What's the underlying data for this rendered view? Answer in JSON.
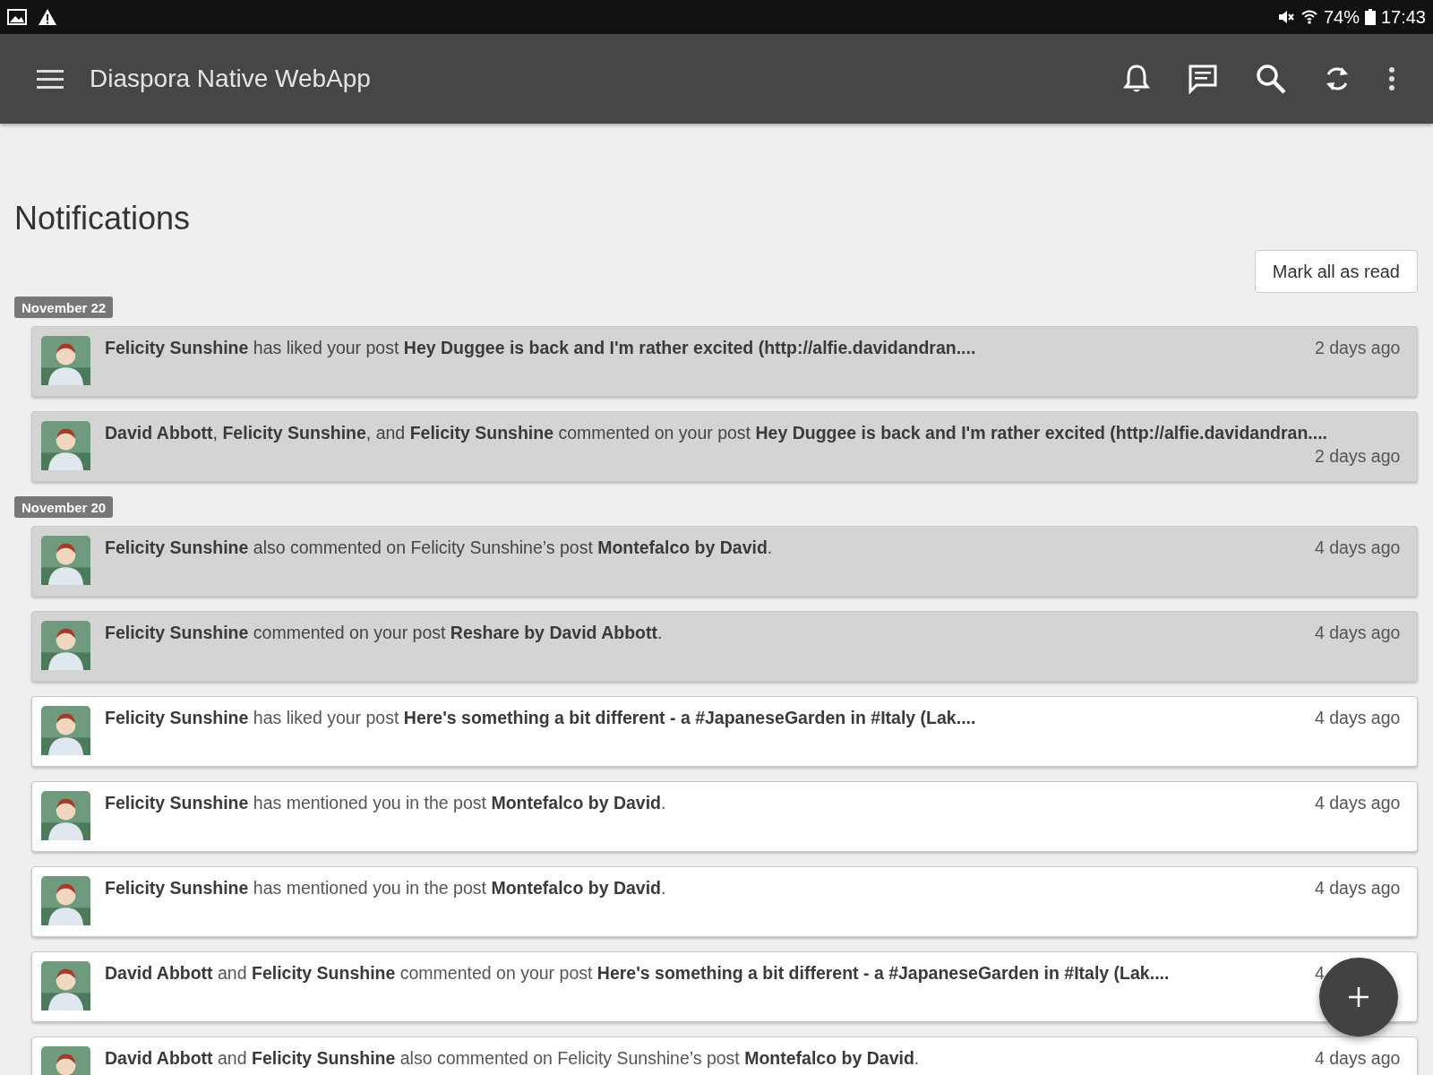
{
  "status_bar": {
    "battery": "74%",
    "time": "17:43"
  },
  "app_bar": {
    "title": "Diaspora Native WebApp"
  },
  "page": {
    "title": "Notifications",
    "mark_all_button": "Mark all as read"
  },
  "groups": [
    {
      "date": "November 22",
      "notifications": [
        {
          "text": "**Felicity Sunshine** has liked your post **Hey Duggee is back and I'm rather excited (http://alfie.davidandran....**",
          "time": "2 days ago",
          "unread": true
        },
        {
          "text": "**David Abbott**, **Felicity Sunshine**, and **Felicity Sunshine** commented on your post **Hey Duggee is back and I'm rather excited (http://alfie.davidandran....**",
          "time": "2 days ago",
          "unread": true
        }
      ]
    },
    {
      "date": "November 20",
      "notifications": [
        {
          "text": "**Felicity Sunshine** also commented on Felicity Sunshine’s post **Montefalco by David**.",
          "time": "4 days ago",
          "unread": true
        },
        {
          "text": "**Felicity Sunshine** commented on your post **Reshare by David Abbott**.",
          "time": "4 days ago",
          "unread": true
        },
        {
          "text": "**Felicity Sunshine** has liked your post **Here's something a bit different - a #JapaneseGarden in #Italy (Lak....**",
          "time": "4 days ago",
          "unread": false
        },
        {
          "text": "**Felicity Sunshine** has mentioned you in the post **Montefalco by David**.",
          "time": "4 days ago",
          "unread": false
        },
        {
          "text": "**Felicity Sunshine** has mentioned you in the post **Montefalco by David**.",
          "time": "4 days ago",
          "unread": false
        },
        {
          "text": "**David Abbott** and **Felicity Sunshine** commented on your post **Here's something a bit different - a #JapaneseGarden in #Italy (Lak....**",
          "time": "4",
          "unread": false
        },
        {
          "text": "**David Abbott** and **Felicity Sunshine** also commented on Felicity Sunshine’s post **Montefalco by David**.",
          "time": "4 days ago",
          "unread": false
        }
      ]
    }
  ]
}
